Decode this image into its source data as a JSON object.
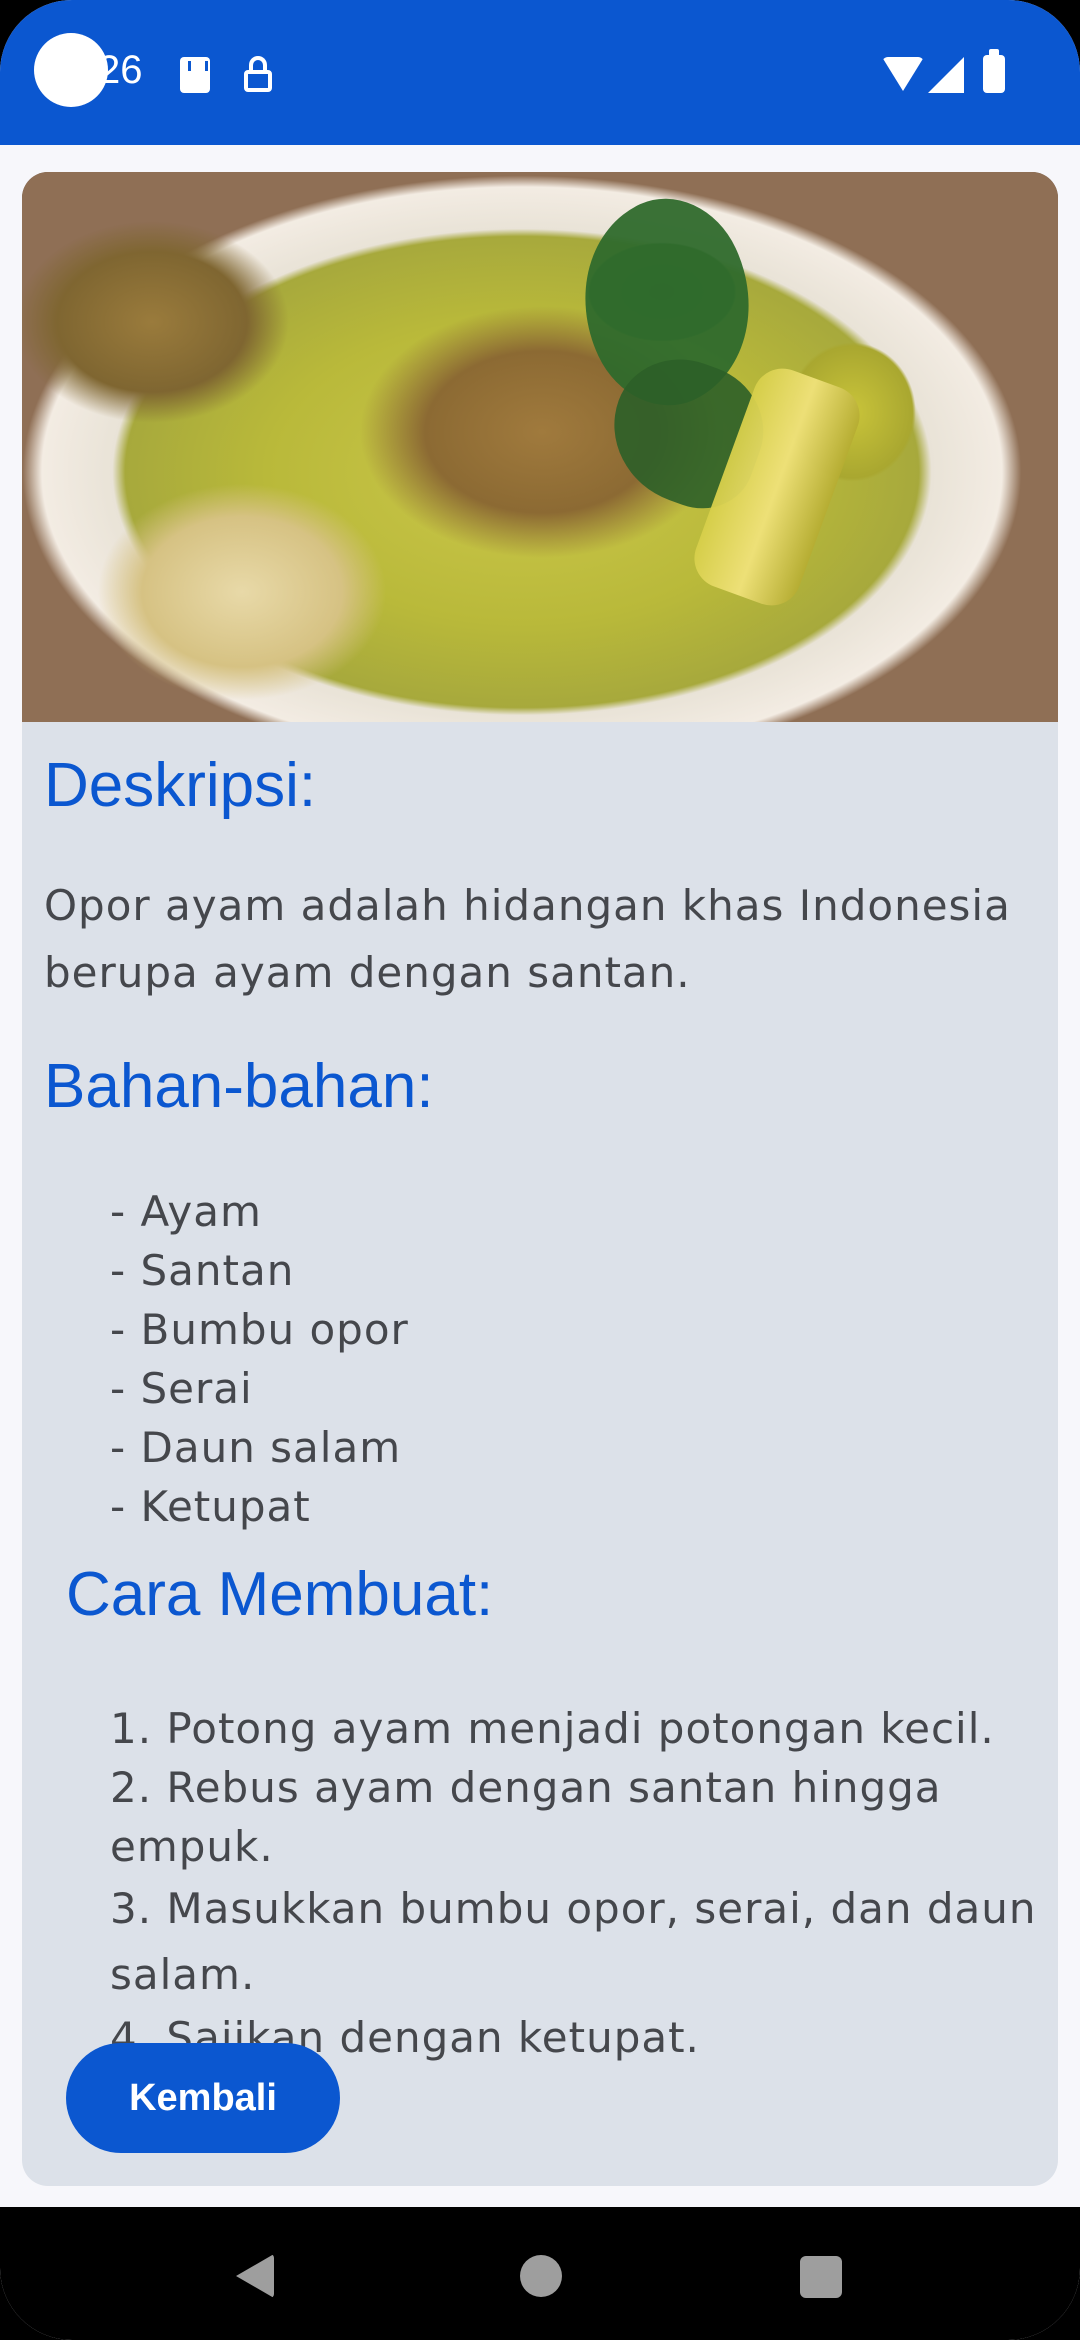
{
  "status_bar": {
    "time": "26"
  },
  "card": {
    "description_title": "Deskripsi:",
    "description_text": "Opor ayam adalah hidangan khas Indonesia berupa ayam dengan santan.",
    "ingredients_title": "Bahan-bahan:",
    "ingredients": [
      "- Ayam",
      "- Santan",
      "- Bumbu opor",
      "- Serai",
      "- Daun salam",
      "- Ketupat"
    ],
    "steps_title": "Cara Membuat:",
    "steps": [
      "1. Potong ayam menjadi potongan kecil.",
      "2. Rebus ayam dengan santan hingga empuk.",
      "3. Masukkan bumbu opor, serai, dan daun salam.",
      "4. Sajikan dengan ketupat."
    ],
    "back_button_label": "Kembali"
  },
  "icons": {
    "status": [
      "sd-card-icon",
      "lock-icon",
      "wifi-icon",
      "signal-icon",
      "battery-icon"
    ],
    "navigation": [
      "back-icon",
      "home-icon",
      "recents-icon"
    ]
  },
  "colors": {
    "primary": "#0b57d0",
    "card_background": "#dce1e9",
    "body_text": "#45474c"
  }
}
